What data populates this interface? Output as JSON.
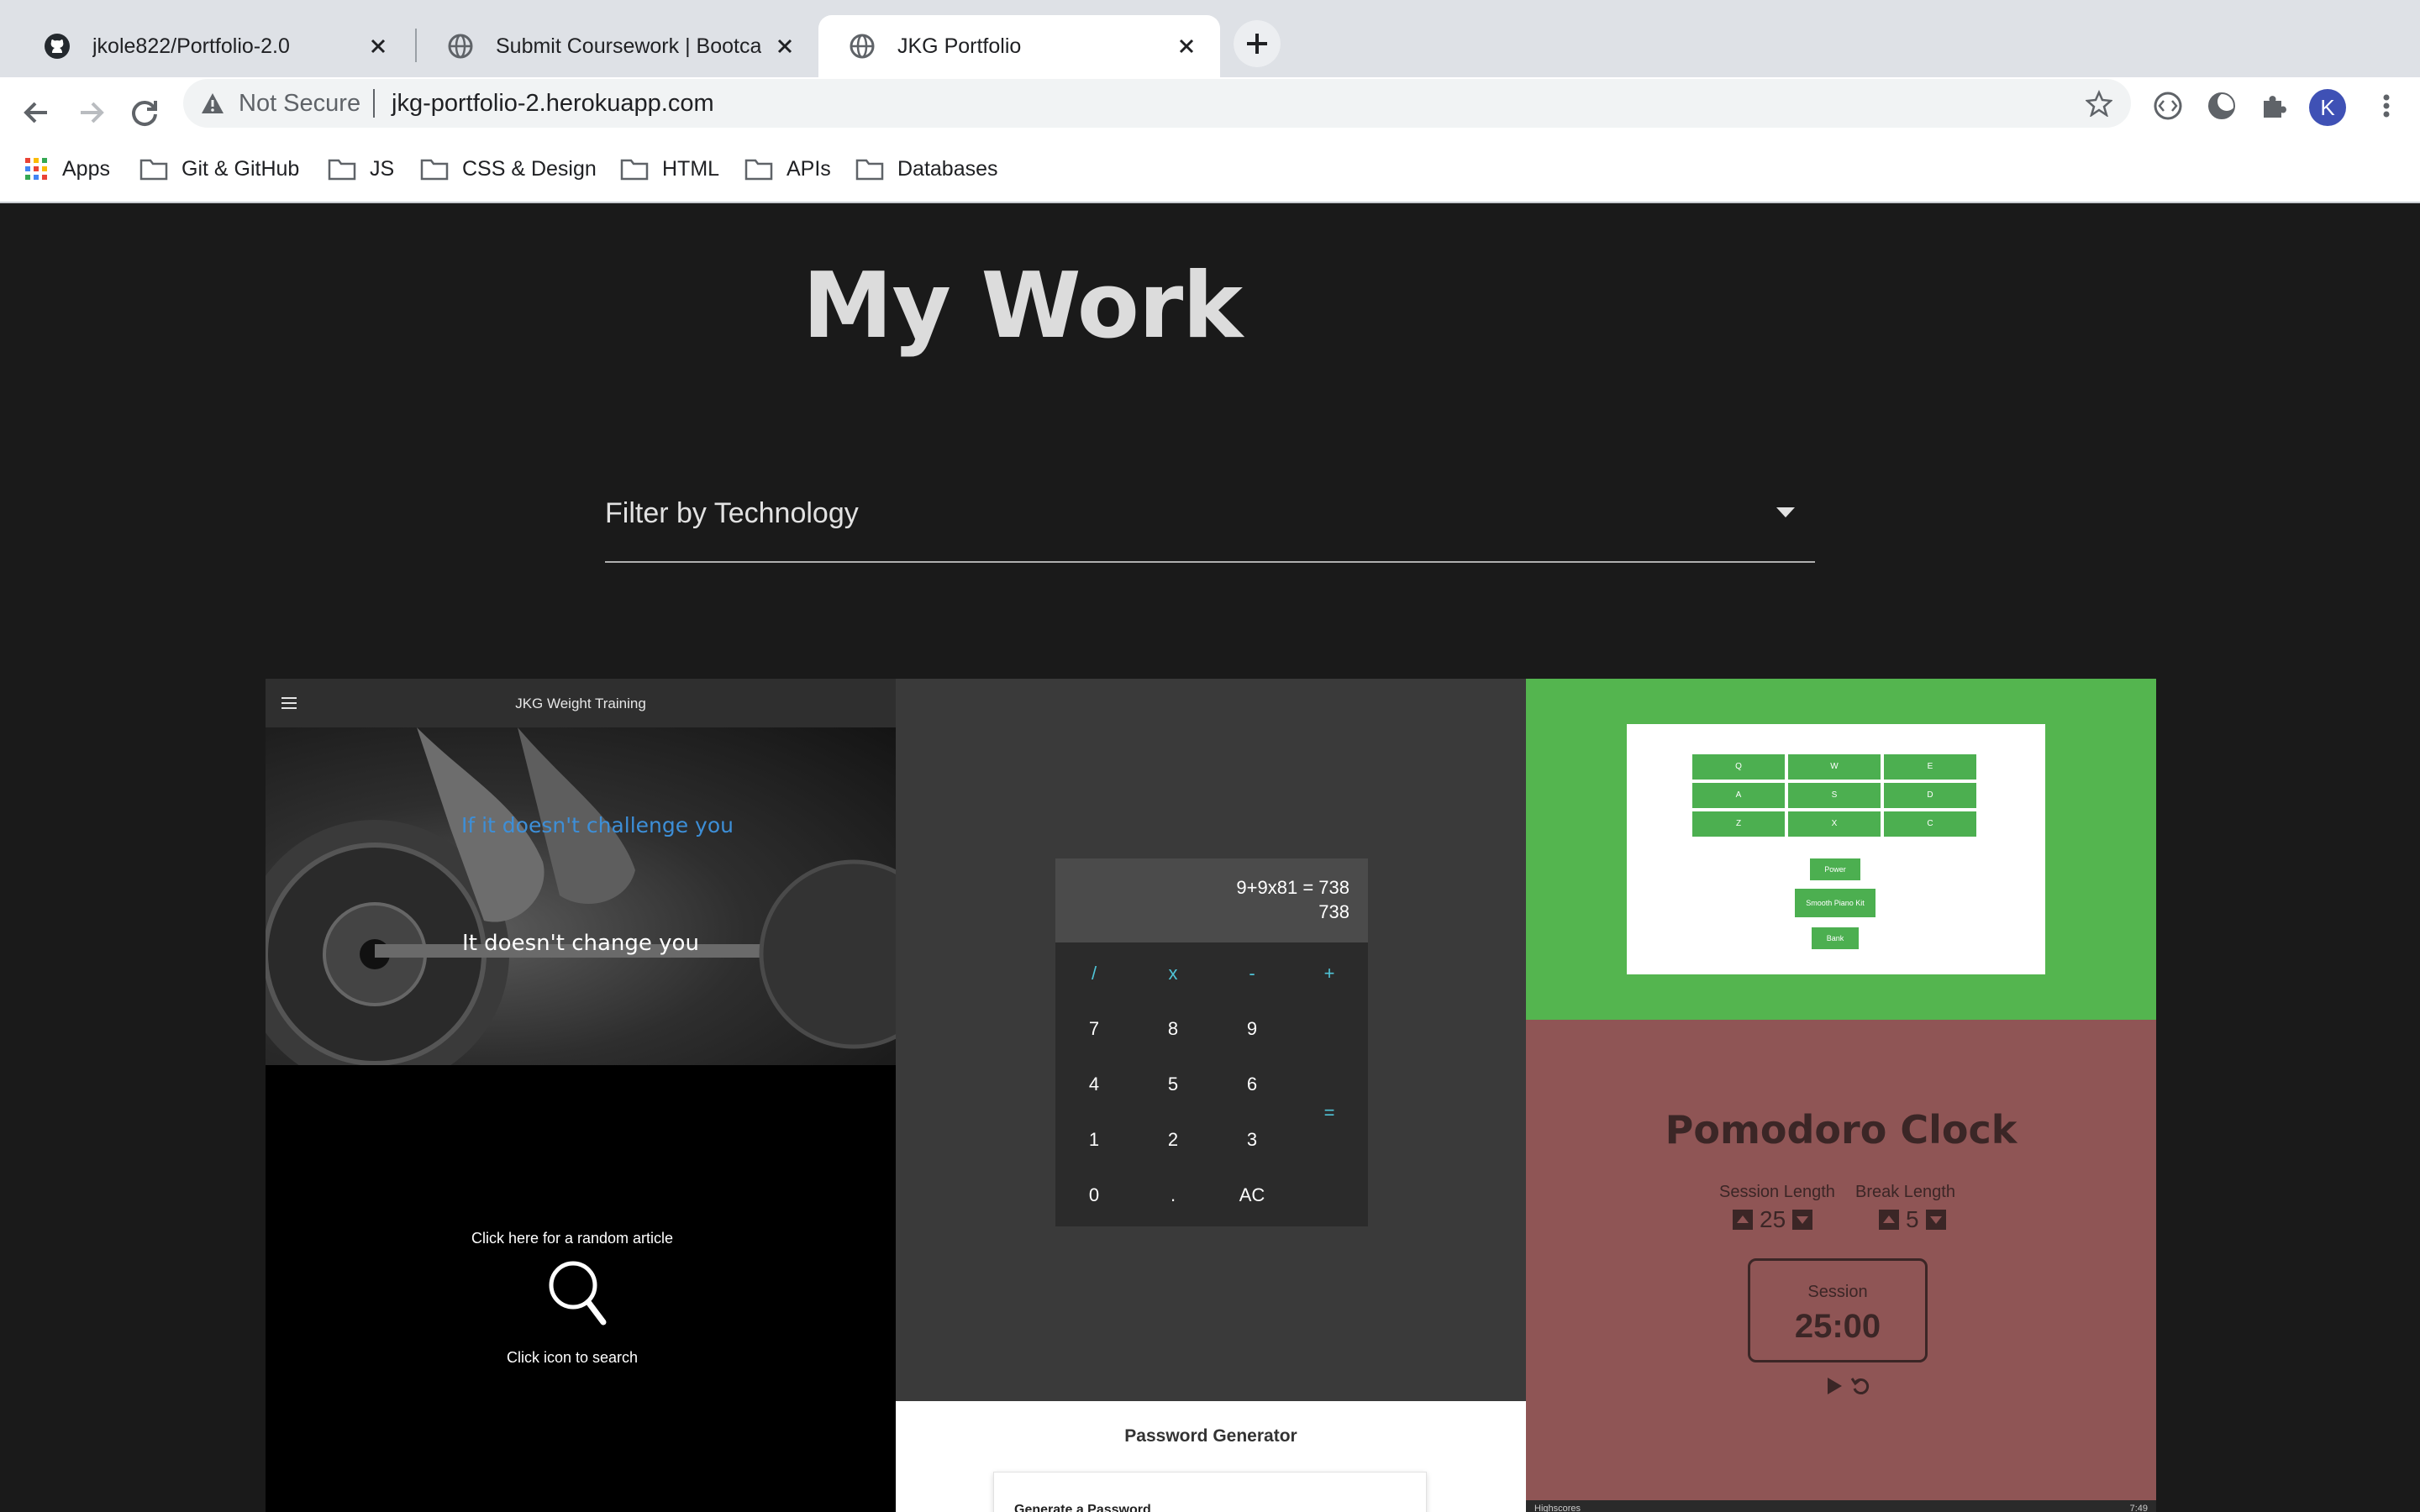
{
  "browser": {
    "tabs": [
      {
        "title": "jkole822/Portfolio-2.0",
        "icon": "github-icon",
        "active": false
      },
      {
        "title": "Submit Coursework | Bootcamp",
        "icon": "globe-icon",
        "active": false
      },
      {
        "title": "JKG Portfolio",
        "icon": "globe-icon",
        "active": true
      }
    ],
    "address_bar": {
      "security_label": "Not Secure",
      "url": "jkg-portfolio-2.herokuapp.com"
    },
    "profile_initial": "K",
    "bookmarks": [
      {
        "label": "Apps",
        "icon": "apps-grid-icon"
      },
      {
        "label": "Git & GitHub",
        "icon": "folder-icon"
      },
      {
        "label": "JS",
        "icon": "folder-icon"
      },
      {
        "label": "CSS & Design",
        "icon": "folder-icon"
      },
      {
        "label": "HTML",
        "icon": "folder-icon"
      },
      {
        "label": "APIs",
        "icon": "folder-icon"
      },
      {
        "label": "Databases",
        "icon": "folder-icon"
      }
    ]
  },
  "page": {
    "title": "My Work",
    "filter": {
      "label": "Filter by Technology"
    },
    "projects": {
      "weight_training": {
        "header": "JKG Weight Training",
        "quote_line1": "If it doesn't challenge you",
        "quote_line2": "It doesn't change you"
      },
      "wiki_viewer": {
        "random_text": "Click here for a random article",
        "search_text": "Click icon to search"
      },
      "calculator": {
        "expression": "9+9x81 = 738",
        "result": "738",
        "keys": {
          "divide": "/",
          "multiply": "x",
          "minus": "-",
          "plus": "+",
          "k7": "7",
          "k8": "8",
          "k9": "9",
          "k4": "4",
          "k5": "5",
          "k6": "6",
          "k1": "1",
          "k2": "2",
          "k3": "3",
          "k0": "0",
          "dot": ".",
          "clear": "AC",
          "equals": "="
        }
      },
      "drum_machine": {
        "pads": [
          "Q",
          "W",
          "E",
          "A",
          "S",
          "D",
          "Z",
          "X",
          "C"
        ],
        "power_label": "Power",
        "kit_label": "Smooth Piano Kit",
        "bank_label": "Bank"
      },
      "pomodoro": {
        "title": "Pomodoro Clock",
        "session_length_label": "Session Length",
        "session_length": "25",
        "break_length_label": "Break Length",
        "break_length": "5",
        "session_label": "Session",
        "time": "25:00"
      },
      "password_generator": {
        "title": "Password Generator",
        "subtitle": "Generate a Password"
      },
      "simon_bar": {
        "left": "Highscores",
        "right": "7:49"
      }
    }
  },
  "colors": {
    "page_bg": "#1a1a1a",
    "drum_green": "#54b54f",
    "pomodoro_red": "#8f5555",
    "calc_accent": "#4fc3d6"
  }
}
